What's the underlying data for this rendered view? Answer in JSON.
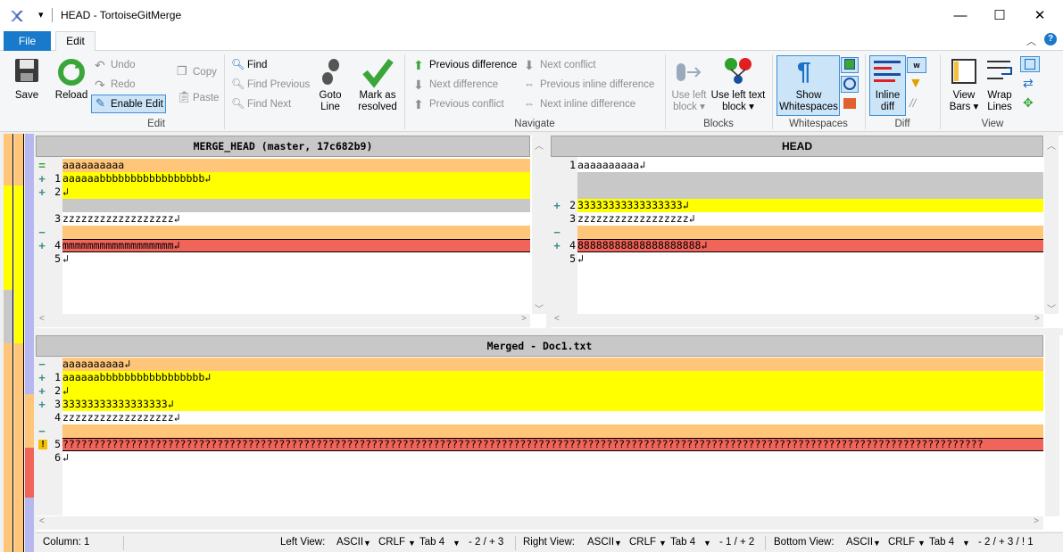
{
  "window": {
    "title": "HEAD - TortoiseGitMerge",
    "qa_label": "▾",
    "minimize": "—",
    "maximize": "☐",
    "close": "✕"
  },
  "tabs": {
    "file": "File",
    "edit": "Edit",
    "collapse": "︿",
    "help": "?"
  },
  "ribbon": {
    "edit": {
      "save": "Save",
      "reload": "Reload",
      "undo": "Undo",
      "redo": "Redo",
      "enable_edit": "Enable Edit",
      "copy": "Copy",
      "paste": "Paste",
      "label": "Edit"
    },
    "find": {
      "find": "Find",
      "find_previous": "Find Previous",
      "find_next": "Find Next",
      "goto_line_1": "Goto",
      "goto_line_2": "Line",
      "mark_resolved_1": "Mark as",
      "mark_resolved_2": "resolved"
    },
    "navigate": {
      "previous_difference": "Previous difference",
      "next_difference": "Next difference",
      "previous_conflict": "Previous conflict",
      "next_conflict": "Next conflict",
      "previous_inline": "Previous inline difference",
      "next_inline": "Next inline difference",
      "label": "Navigate"
    },
    "blocks": {
      "use_left_block_1": "Use left",
      "use_left_block_2": "block ▾",
      "use_left_text_1": "Use left text",
      "use_left_text_2": "block ▾",
      "label": "Blocks"
    },
    "whitespaces": {
      "show_1": "Show",
      "show_2": "Whitespaces",
      "label": "Whitespaces"
    },
    "diff": {
      "inline_1": "Inline",
      "inline_2": "diff",
      "label": "Diff"
    },
    "view": {
      "view_bars_1": "View",
      "view_bars_2": "Bars ▾",
      "wrap_1": "Wrap",
      "wrap_2": "Lines",
      "label": "View"
    }
  },
  "left_pane": {
    "header": "MERGE_HEAD (master, 17c682b9)",
    "lines": [
      {
        "mark": "=",
        "num": "",
        "text": "aaaaaaaaaa",
        "bg": "#ffc67a"
      },
      {
        "mark": "+",
        "num": "1",
        "text": "aaaaaabbbbbbbbbbbbbbbbb↲",
        "bg": "#ffff00"
      },
      {
        "mark": "+",
        "num": "2",
        "text": "↲",
        "bg": "#ffff00"
      },
      {
        "mark": "",
        "num": "",
        "text": "",
        "bg": "#c8c8c8"
      },
      {
        "mark": "",
        "num": "3",
        "text": "zzzzzzzzzzzzzzzzzz↲",
        "bg": "#ffffff"
      },
      {
        "mark": "−",
        "num": "",
        "text": "",
        "bg": "#ffc67a"
      },
      {
        "mark": "+",
        "num": "4",
        "text": "mmmmmmmmmmmmmmmmmm↲",
        "bg": "#f0645a"
      },
      {
        "mark": "",
        "num": "5",
        "text": "↲",
        "bg": "#ffffff"
      }
    ]
  },
  "right_pane": {
    "header": "HEAD",
    "lines": [
      {
        "mark": "",
        "num": "1",
        "text": "aaaaaaaaaa↲",
        "bg": "#ffffff"
      },
      {
        "mark": "",
        "num": "",
        "text": "",
        "bg": "#c8c8c8"
      },
      {
        "mark": "",
        "num": "",
        "text": "",
        "bg": "#c8c8c8"
      },
      {
        "mark": "+",
        "num": "2",
        "text": "33333333333333333↲",
        "bg": "#ffff00"
      },
      {
        "mark": "",
        "num": "3",
        "text": "zzzzzzzzzzzzzzzzzz↲",
        "bg": "#ffffff"
      },
      {
        "mark": "−",
        "num": "",
        "text": "",
        "bg": "#ffc67a"
      },
      {
        "mark": "+",
        "num": "4",
        "text": "88888888888888888888↲",
        "bg": "#f0645a"
      },
      {
        "mark": "",
        "num": "5",
        "text": "↲",
        "bg": "#ffffff"
      }
    ]
  },
  "bottom_pane": {
    "header": "Merged - Doc1.txt",
    "lines": [
      {
        "mark": "−",
        "num": "",
        "text": "aaaaaaaaaa↲",
        "bg": "#ffc67a"
      },
      {
        "mark": "+",
        "num": "1",
        "text": "aaaaaabbbbbbbbbbbbbbbbb↲",
        "bg": "#ffff00"
      },
      {
        "mark": "+",
        "num": "2",
        "text": "↲",
        "bg": "#ffff00"
      },
      {
        "mark": "+",
        "num": "3",
        "text": "33333333333333333↲",
        "bg": "#ffff00"
      },
      {
        "mark": "",
        "num": "4",
        "text": "zzzzzzzzzzzzzzzzzz↲",
        "bg": "#ffffff"
      },
      {
        "mark": "−",
        "num": "",
        "text": "",
        "bg": "#ffc67a"
      },
      {
        "mark": "!",
        "num": "5",
        "text": "?????????????????????????????????????????????????????????????????????????????????????????????????????????????????????????????????????????????????????",
        "bg": "#f0645a"
      },
      {
        "mark": "",
        "num": "6",
        "text": "↲",
        "bg": "#ffffff"
      }
    ]
  },
  "status": {
    "column": "Column: 1",
    "left_view": "Left View:",
    "right_view": "Right View:",
    "bottom_view": "Bottom View:",
    "left_enc": "ASCII",
    "left_eol": "CRLF",
    "left_tab": "Tab 4",
    "left_counts": "- 2 / + 3",
    "right_enc": "ASCII",
    "right_eol": "CRLF",
    "right_tab": "Tab 4",
    "right_counts": "- 1 / + 2",
    "bottom_enc": "ASCII",
    "bottom_eol": "CRLF",
    "bottom_tab": "Tab 4",
    "bottom_counts": "- 2 / + 3 / ! 1"
  }
}
